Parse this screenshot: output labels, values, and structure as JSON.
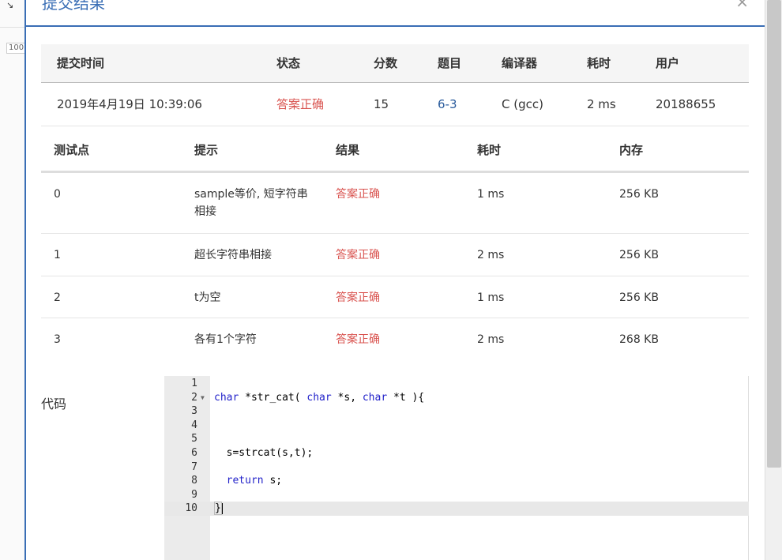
{
  "background": {
    "strip_text": "100"
  },
  "modal": {
    "title": "提交结果",
    "close": "×"
  },
  "summary": {
    "headers": [
      "提交时间",
      "状态",
      "分数",
      "题目",
      "编译器",
      "耗时",
      "用户"
    ],
    "row": {
      "time": "2019年4月19日 10:39:06",
      "status": "答案正确",
      "score": "15",
      "problem": "6-3",
      "compiler": "C (gcc)",
      "duration": "2 ms",
      "user": "20188655"
    }
  },
  "cases": {
    "headers": [
      "测试点",
      "提示",
      "结果",
      "耗时",
      "内存"
    ],
    "rows": [
      {
        "id": "0",
        "hint": "sample等价, 短字符串相接",
        "result": "答案正确",
        "duration": "1 ms",
        "memory": "256 KB"
      },
      {
        "id": "1",
        "hint": "超长字符串相接",
        "result": "答案正确",
        "duration": "2 ms",
        "memory": "256 KB"
      },
      {
        "id": "2",
        "hint": "t为空",
        "result": "答案正确",
        "duration": "1 ms",
        "memory": "256 KB"
      },
      {
        "id": "3",
        "hint": "各有1个字符",
        "result": "答案正确",
        "duration": "2 ms",
        "memory": "268 KB"
      }
    ]
  },
  "code": {
    "label": "代码",
    "line_numbers": [
      "1",
      "2",
      "3",
      "4",
      "5",
      "6",
      "7",
      "8",
      "9",
      "10"
    ],
    "l2_kw1": "char",
    "l2_mid1": " *str_cat( ",
    "l2_kw2": "char",
    "l2_mid2": " *s, ",
    "l2_kw3": "char",
    "l2_mid3": " *t ",
    "l2_end": "){",
    "l6": "  s=strcat(s,t);",
    "l8_kw": "return",
    "l8_rest": " s;",
    "l10": "}"
  },
  "colors": {
    "accent": "#3a6eb5",
    "success": "#d9534f",
    "link": "#2a5b9c"
  }
}
